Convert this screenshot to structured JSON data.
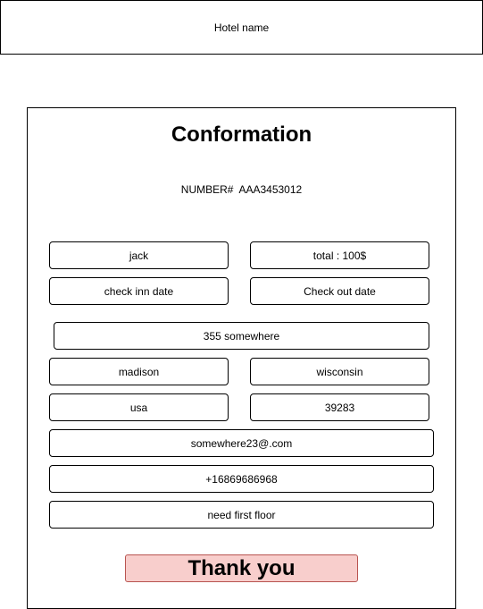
{
  "header": {
    "hotel_name": "Hotel name"
  },
  "confirmation": {
    "title": "Conformation",
    "number_label": "NUMBER#",
    "number_value": "AAA3453012",
    "fields": {
      "name": "jack",
      "total": "total : 100$",
      "check_in": "check inn date",
      "check_out": "Check out date",
      "street": "355 somewhere",
      "city": "madison",
      "state": "wisconsin",
      "country": "usa",
      "zip": "39283",
      "email": "somewhere23@.com",
      "phone": "+16869686968",
      "notes": "need first floor"
    },
    "thank_you_label": "Thank you",
    "thank_you_color": "#f8cecc",
    "thank_you_border_color": "#b85450"
  }
}
